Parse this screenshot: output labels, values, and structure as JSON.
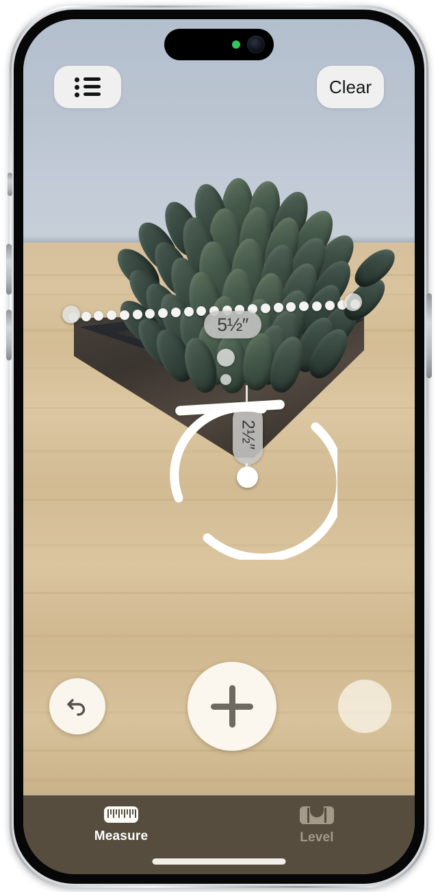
{
  "app": {
    "name": "Measure",
    "device": "iPhone"
  },
  "status": {
    "camera_in_use_indicator": "green-dot",
    "camera_lens": "front-camera"
  },
  "topbar": {
    "list_button": {
      "label": "",
      "icon": "list-bullet-icon"
    },
    "clear_button": {
      "label": "Clear"
    }
  },
  "ar_overlay": {
    "measurements": [
      {
        "id": "horizontal",
        "value": "5",
        "fraction_num": "1",
        "fraction_den": "2",
        "unit": "″",
        "display": "5½″",
        "orientation": "horizontal"
      },
      {
        "id": "vertical",
        "value": "2",
        "fraction_num": "1",
        "fraction_den": "2",
        "unit": "″",
        "display": "2½″",
        "orientation": "vertical"
      }
    ],
    "reticle": "focus-ring",
    "focus_point": "white-dot"
  },
  "controls": {
    "undo_button": {
      "icon": "undo-arrow-icon",
      "label": ""
    },
    "add_button": {
      "icon": "plus-icon",
      "label": ""
    },
    "shutter_button": {
      "icon": "shutter-icon",
      "label": ""
    }
  },
  "tabbar": {
    "tabs": [
      {
        "label": "Measure",
        "icon": "ruler-icon",
        "active": true
      },
      {
        "label": "Level",
        "icon": "level-icon",
        "active": false
      }
    ]
  },
  "colors": {
    "wall": "#b8c2d0",
    "table": "#d4bc94",
    "pot": "#3b352f",
    "plant": "#42564a",
    "tabbar": "#564d3e",
    "accent_white": "#ffffff",
    "pill_gray": "#c6c6c4",
    "green_indicator": "#34c759"
  },
  "home_indicator": "home-bar"
}
